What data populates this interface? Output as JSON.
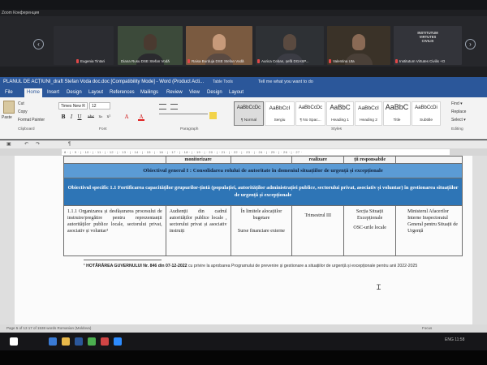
{
  "meeting": {
    "app_title": "Zoom Конференция",
    "nav_left": "‹",
    "nav_right": "›",
    "participants": [
      {
        "name": "Eugenia Tintari"
      },
      {
        "name": "Diana Rusu DSE Stefan Vodă"
      },
      {
        "name": "Raisa Burduja DSE Stefan Vodă"
      },
      {
        "name": "Aurica Ceban, șefă DGASP..."
      },
      {
        "name": "Valentina Uta"
      },
      {
        "name": "Institutum Virtutes Civilis +O"
      }
    ],
    "logo_lines": [
      "INSTITUTUM",
      "VIRTUTES",
      "CIVILIS"
    ]
  },
  "word": {
    "title": "PLANUL DE ACȚIUNI_draft Stefan Voda doc.doc [Compatibility Mode] - Word (Product Acti...",
    "table_tools": "Table Tools",
    "tell_me": "Tell me what you want to do",
    "tabs": [
      "File",
      "Home",
      "Insert",
      "Design",
      "Layout",
      "References",
      "Mailings",
      "Review",
      "View",
      "Design",
      "Layout"
    ],
    "active_tab_index": 1,
    "ribbon": {
      "paste": "Paste",
      "cut": "Cut",
      "copy": "Copy",
      "format_painter": "Format Painter",
      "font_name": "Times New R",
      "font_size": "12",
      "groups": [
        "Clipboard",
        "Font",
        "Paragraph",
        "Styles",
        "Editing"
      ],
      "format_buttons": [
        "B",
        "I",
        "U",
        "abc",
        "x₂",
        "x²",
        "A",
        "A"
      ],
      "styles": [
        {
          "preview": "AaBbCcDc",
          "name": "¶ Normal",
          "selected": true
        },
        {
          "preview": "AaBbCcI",
          "name": "Sergiu",
          "selected": false
        },
        {
          "preview": "AaBbCcDc",
          "name": "¶ No Spac...",
          "selected": false
        },
        {
          "preview": "AaBbC",
          "name": "Heading 1",
          "selected": false
        },
        {
          "preview": "AaBbCcI",
          "name": "Heading 2",
          "selected": false
        },
        {
          "preview": "AaBbC",
          "name": "Title",
          "selected": false
        },
        {
          "preview": "AaBbCcDi",
          "name": "Subtitle",
          "selected": false
        }
      ],
      "editing": [
        "Find ▾",
        "Replace",
        "Select ▾"
      ]
    },
    "ruler_text": "· 8 · | · 9 · | · 10 · | · 11 · | · 12 · | · 13 · | · 14 · | · 15 · | · 16 · | · 17 · | · 18 · | · 19 · | · 20 · | · 21 · | · 22 · | · 23 · | · 24 · | · 25 · | · 26 · | · 27 ·",
    "table": {
      "header_cells": [
        "",
        "monitorizare",
        "",
        "realizare",
        "ții responsabile",
        ""
      ],
      "objective_general": "Obiectivul general I : Consolidarea rolului de autoritate în domeniul situațiilor de urgență și excepționale",
      "objective_specific": "Obiectivul specific 1.1 Fortificarea capacităților grupurilor-țintă (populației, autorităților administrației publice, sectorului privat, asociativ și voluntar) în gestionarea situațiilor de urgență și excepționale",
      "row": {
        "action": "1.1.1 Organizarea și desfășurarea procesului de instruire/pregătire pentru reprezentanții autorităților publice locale, sectorului privat, asociativ și voluntar¹",
        "indicator": "Audienții din cadrul autorităților publice locale , sectorului privat și asociativ instruiți",
        "cost": "În limitele alocațiilor bugetare",
        "source": "Surse financiare externe",
        "term": "Trimestrul III",
        "responsible_1": "Secția Situații Excepționale",
        "responsible_2": "OSC-urile locale",
        "partners": "Ministerul Afacerilor Interne Inspectoratul General pentru Situații de Urgență"
      }
    },
    "footnote_prefix": "¹ HOTĂRÂREA GUVERNULUI Nr. 846 din 07-12-2022",
    "footnote_rest": " cu privire la aprobarea Programului de prevenire și gestionare a situațiilor de urgență și excepționale pentru anii 2022-2025",
    "status_left": "Page 5 of 13    17 of 1538 words    Romanian (Moldova)",
    "status_right": "Focus"
  },
  "taskbar": {
    "tray": "ENG  11:58",
    "icon_colors": [
      "#ffffff",
      "#3a7bd5",
      "#e8b84a",
      "#2b579a",
      "#4caf50",
      "#d04545",
      "#2d8cff"
    ]
  }
}
